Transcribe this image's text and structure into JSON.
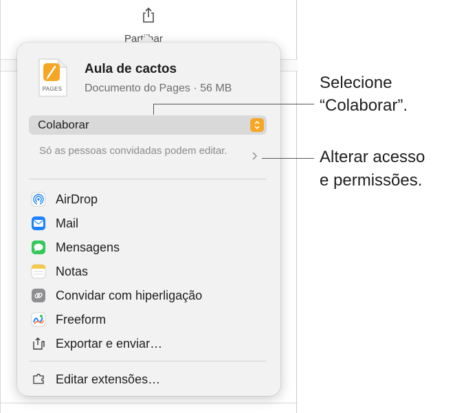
{
  "toolbar": {
    "share_label": "Partilhar"
  },
  "document": {
    "thumb_label": "PAGES",
    "title": "Aula de cactos",
    "subtitle": "Documento do Pages · 56 MB"
  },
  "collaboration": {
    "select_value": "Colaborar",
    "access_text": "Só as pessoas convidadas podem editar."
  },
  "menu": {
    "items": [
      {
        "label": "AirDrop",
        "icon": "airdrop-icon"
      },
      {
        "label": "Mail",
        "icon": "mail-icon"
      },
      {
        "label": "Mensagens",
        "icon": "messages-icon"
      },
      {
        "label": "Notas",
        "icon": "notes-icon"
      },
      {
        "label": "Convidar com hiperligação",
        "icon": "link-icon"
      },
      {
        "label": "Freeform",
        "icon": "freeform-icon"
      },
      {
        "label": "Exportar e enviar…",
        "icon": "export-icon"
      }
    ],
    "edit_extensions": "Editar extensões…"
  },
  "callouts": {
    "select_line1": "Selecione",
    "select_line2": "“Colaborar”.",
    "access_line1": "Alterar acesso",
    "access_line2": "e permissões."
  },
  "colors": {
    "accent_orange": "#f5a623",
    "mail_blue": "#1a82fb",
    "messages_green": "#34c759"
  }
}
